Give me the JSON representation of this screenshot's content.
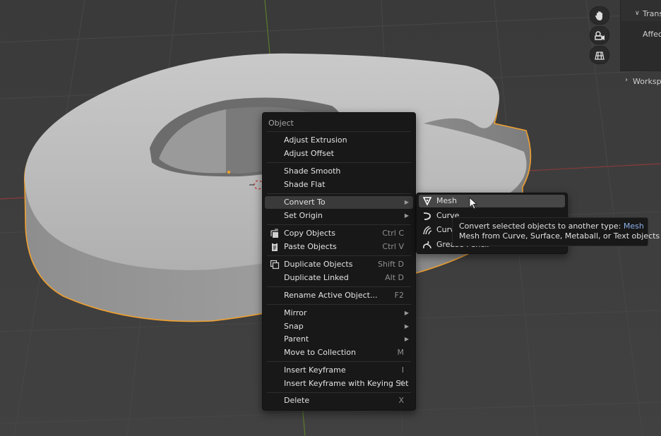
{
  "menu": {
    "title": "Object",
    "items": [
      {
        "label": "Adjust Extrusion",
        "shortcut": "",
        "submenu": false
      },
      {
        "label": "Adjust Offset",
        "shortcut": "",
        "submenu": false
      },
      {
        "label": "Shade Smooth",
        "shortcut": "",
        "submenu": false
      },
      {
        "label": "Shade Flat",
        "shortcut": "",
        "submenu": false
      },
      {
        "label": "Convert To",
        "shortcut": "",
        "submenu": true,
        "active": true
      },
      {
        "label": "Set Origin",
        "shortcut": "",
        "submenu": true
      },
      {
        "label": "Copy Objects",
        "shortcut": "Ctrl C",
        "icon": "copy-icon"
      },
      {
        "label": "Paste Objects",
        "shortcut": "Ctrl V",
        "icon": "paste-icon"
      },
      {
        "label": "Duplicate Objects",
        "shortcut": "Shift D",
        "icon": "duplicate-icon"
      },
      {
        "label": "Duplicate Linked",
        "shortcut": "Alt D"
      },
      {
        "label": "Rename Active Object...",
        "shortcut": "F2"
      },
      {
        "label": "Mirror",
        "shortcut": "",
        "submenu": true
      },
      {
        "label": "Snap",
        "shortcut": "",
        "submenu": true
      },
      {
        "label": "Parent",
        "shortcut": "",
        "submenu": true
      },
      {
        "label": "Move to Collection",
        "shortcut": "M"
      },
      {
        "label": "Insert Keyframe",
        "shortcut": "I"
      },
      {
        "label": "Insert Keyframe with Keying Set",
        "shortcut": "K"
      },
      {
        "label": "Delete",
        "shortcut": "X"
      }
    ]
  },
  "submenu": {
    "items": [
      {
        "label": "Mesh",
        "icon": "mesh-icon",
        "active": true
      },
      {
        "label": "Curve",
        "icon": "curve-icon"
      },
      {
        "label": "Curve",
        "icon": "curves-icon"
      },
      {
        "label": "Grease Pencil",
        "icon": "grease-pencil-icon"
      }
    ]
  },
  "tooltip": {
    "line1_prefix": "Convert selected objects to another type: ",
    "line1_highlight": "Mesh",
    "line2": "Mesh from Curve, Surface, Metaball, or Text objects"
  },
  "panel": {
    "transform_label": "Trans",
    "affect_label": "Affec",
    "workspace_label": "Workspa"
  },
  "toolbar_icons": [
    "hand-icon",
    "camera-icon",
    "grid-icon"
  ],
  "colors": {
    "selection_outline": "#f0a030",
    "menu_bg": "#181818",
    "tooltip_highlight": "#8aaee8"
  }
}
